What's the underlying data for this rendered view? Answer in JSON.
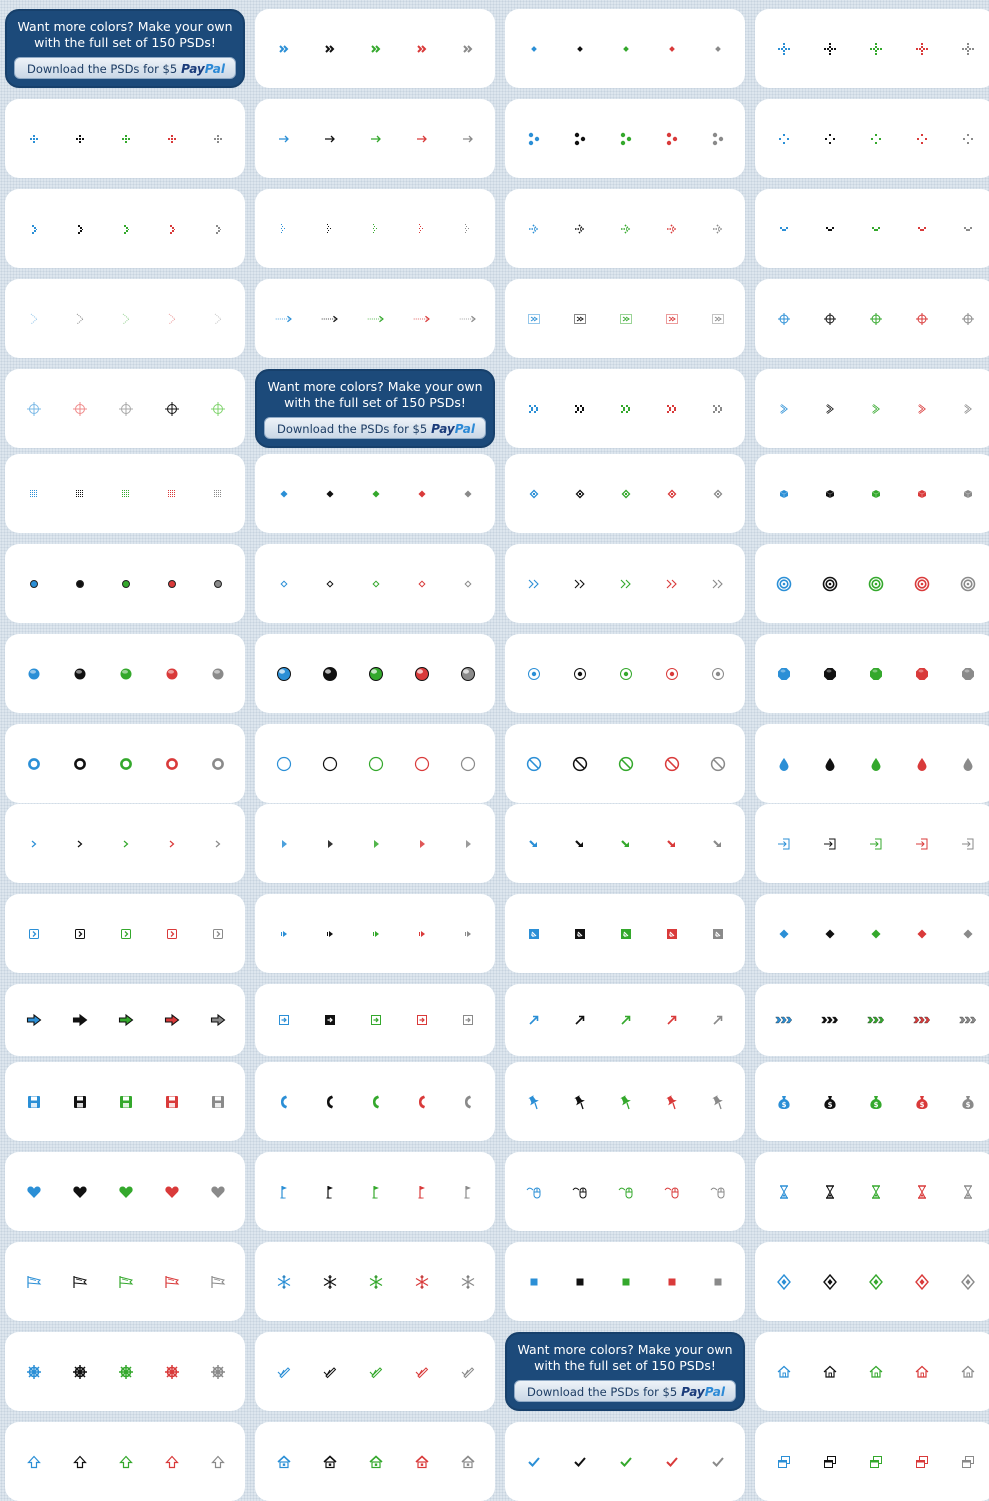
{
  "promo": {
    "headline": "Want more colors? Make your own with the full set of 150 PSDs!",
    "button_label": "Download the PSDs for $5",
    "paypal_a": "Pay",
    "paypal_b": "Pal"
  },
  "colors": {
    "blue": "#2b8fd6",
    "black": "#111111",
    "green": "#34a82c",
    "red": "#d93a3a",
    "grey": "#8a8a8a",
    "light_blue": "#79b8e6",
    "light_red": "#ef8a8a",
    "light_grey": "#a8a8a8",
    "light_green": "#7fd36c"
  },
  "palette_order": [
    "blue",
    "black",
    "green",
    "red",
    "grey"
  ],
  "cards": [
    [
      "promo",
      "double-chevron-icon",
      "dot-diamond-icon",
      "crosshair-dotted-icon"
    ],
    [
      "pixel-diamond-icon",
      "arrow-right-thin-icon",
      "three-dots-icon",
      "pixel-diamond-outline-icon"
    ],
    [
      "pixel-arrow-right-icon",
      "dotted-arrow-right-icon",
      "pixel-arrow-hatched-icon",
      "pixel-down-icon"
    ],
    [
      "faint-arrow-right-icon",
      "dotted-long-arrow-icon",
      "hatched-square-icon",
      "crosshair-small-icon"
    ],
    [
      "target-crosshair-icon",
      "promo",
      "pixel-double-chevron-icon",
      "outline-chevron-icon"
    ],
    [
      "dotted-square-icon",
      "small-diamond-icon",
      "diamond-dot-icon",
      "cube-icon"
    ],
    [
      "filled-dot-icon",
      "tiny-diamond-icon",
      "double-chevron-thin-icon",
      "concentric-circle-icon"
    ],
    [
      "glossy-ball-icon",
      "glossy-orb-icon",
      "radio-dot-icon",
      "octagon-ball-icon"
    ],
    [
      "ring-thick-icon",
      "ring-thin-icon",
      "no-sign-icon",
      "droplet-icon"
    ],
    [
      "chevron-small-icon",
      "triangle-right-icon",
      "arrow-down-right-icon",
      "enter-icon"
    ],
    [
      "boxed-chevron-icon",
      "play-small-icon",
      "box-arrow-icon",
      "diamond-solid-icon"
    ],
    [
      "fat-arrow-icon",
      "box-arrow-right-icon",
      "arrow-up-right-icon",
      "triple-chevron-icon"
    ],
    [
      "floppy-disk-icon",
      "phone-handset-icon",
      "pushpin-icon",
      "money-bag-icon"
    ],
    [
      "heart-icon",
      "golf-flag-icon",
      "mouse-icon",
      "hourglass-icon"
    ],
    [
      "pennant-flag-icon",
      "snowflake-icon",
      "square-solid-icon",
      "diamond-eye-icon"
    ],
    [
      "ship-wheel-icon",
      "pencil-check-icon",
      "promo",
      "home-outline-icon"
    ],
    [
      "up-arrow-outline-icon",
      "home-icon",
      "checkmark-icon",
      "window-copy-icon"
    ]
  ]
}
